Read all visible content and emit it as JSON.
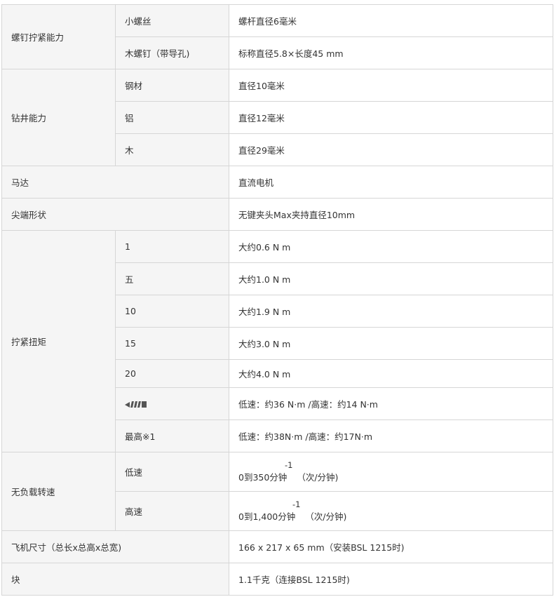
{
  "rows": {
    "screw": {
      "label": "螺钉拧紧能力",
      "small_label": "小螺丝",
      "small_value": "螺杆直径6毫米",
      "wood_label": "木螺钉（带导孔)",
      "wood_value": "标称直径5.8×长度45 mm"
    },
    "drill": {
      "label": "钻井能力",
      "steel_label": "钢材",
      "steel_value": "直径10毫米",
      "alu_label": "铝",
      "alu_value": "直径12毫米",
      "wood_label": "木",
      "wood_value": "直径29毫米"
    },
    "motor": {
      "label": "马达",
      "value": "直流电机"
    },
    "tip": {
      "label": "尖端形状",
      "value": "无键夹头Max夹持直径10mm"
    },
    "torque": {
      "label": "拧紧扭矩",
      "items": [
        {
          "label": "1",
          "value": "大约0.6 N m"
        },
        {
          "label": "五",
          "value": "大约1.0 N m"
        },
        {
          "label": "10",
          "value": "大约1.9 N m"
        },
        {
          "label": "15",
          "value": "大约3.0 N m"
        },
        {
          "label": "20",
          "value": "大约4.0 N m"
        },
        {
          "icon": "drill-mode-icon",
          "value": "低速：约36 N·m /高速：约14 N·m"
        },
        {
          "label": "最高※1",
          "value": "低速：约38N·m /高速：约17N·m"
        }
      ]
    },
    "noload": {
      "label": "无负载转速",
      "low_label": "低速",
      "low_value": "0到350分钟",
      "low_exp": "-1",
      "low_unit": "（次/分钟)",
      "high_label": "高速",
      "high_value": "0到1,400分钟",
      "high_exp": "-1",
      "high_unit": "（次/分钟)"
    },
    "size": {
      "label": "飞机尺寸（总长x总高x总宽)",
      "value": "166 x 217 x 65 mm（安装BSL 1215时)"
    },
    "mass": {
      "label": "块",
      "value": "1.1千克（连接BSL 1215时)"
    }
  }
}
